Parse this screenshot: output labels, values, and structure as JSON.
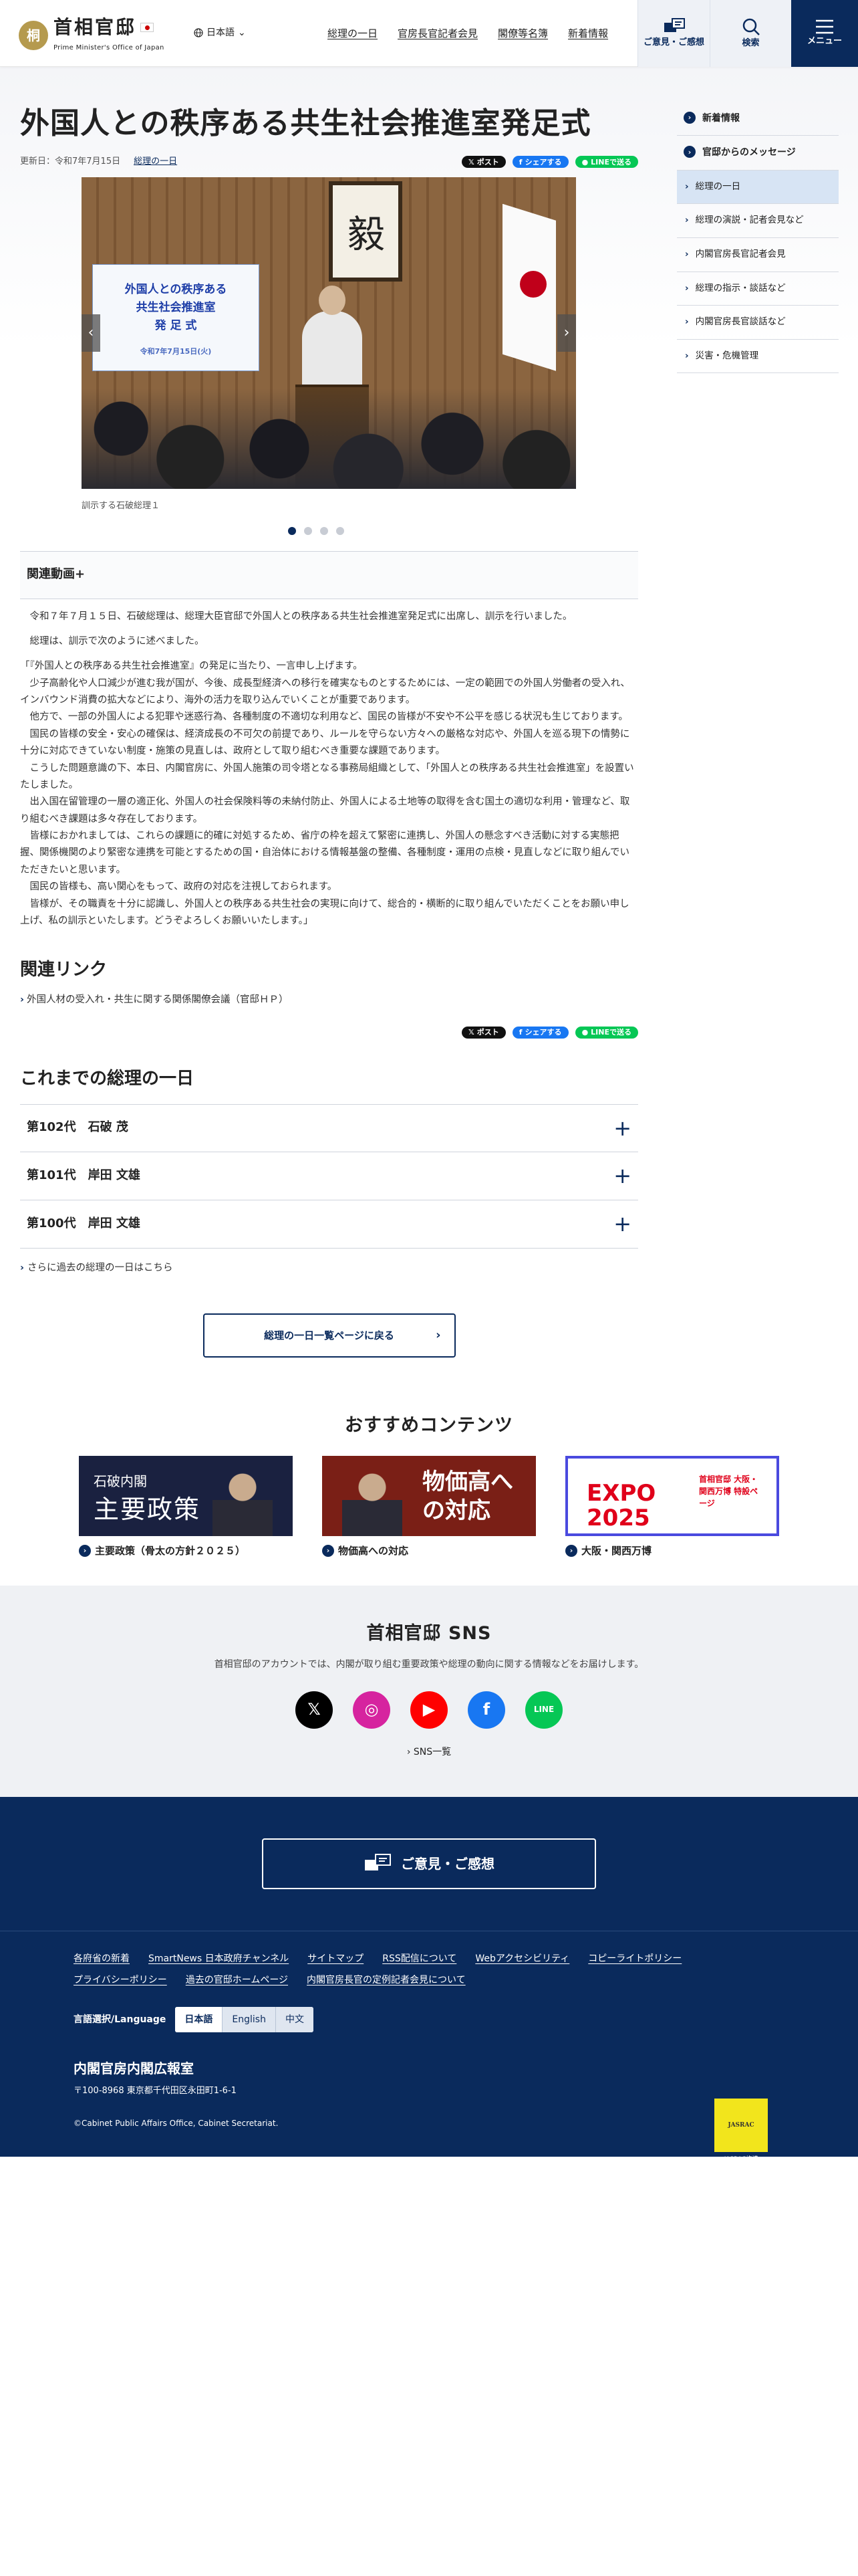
{
  "header": {
    "logo_ja": "首相官邸",
    "logo_en": "Prime Minister's Office of Japan",
    "lang": "日本語",
    "nav": [
      "総理の一日",
      "官房長官記者会見",
      "閣僚等名簿",
      "新着情報"
    ],
    "opinion": "ご意見・ご感想",
    "search": "検索",
    "menu": "メニュー"
  },
  "article": {
    "title": "外国人との秩序ある共生社会推進室発足式",
    "updated": "更新日：令和7年7月15日",
    "category": "総理の一日",
    "share": {
      "x": "ポスト",
      "fb": "シェアする",
      "line": "LINEで送る"
    },
    "slide": {
      "sign_lines": [
        "外国人との秩序ある",
        "共生社会推進室",
        "発 足 式"
      ],
      "sign_date": "令和7年7月15日(火)",
      "caption": "訓示する石破総理１",
      "count": 4,
      "active": 1
    },
    "video_label": "関連動画",
    "para1": "令和７年７月１５日、石破総理は、総理大臣官邸で外国人との秩序ある共生社会推進室発足式に出席し、訓示を行いました。",
    "para2": "総理は、訓示で次のように述べました。",
    "speech": [
      "「『外国人との秩序ある共生社会推進室』の発足に当たり、一言申し上げます。",
      "少子高齢化や人口減少が進む我が国が、今後、成長型経済への移行を確実なものとするためには、一定の範囲での外国人労働者の受入れ、インバウンド消費の拡大などにより、海外の活力を取り込んでいくことが重要であります。",
      "他方で、一部の外国人による犯罪や迷惑行為、各種制度の不適切な利用など、国民の皆様が不安や不公平を感じる状況も生じております。",
      "国民の皆様の安全・安心の確保は、経済成長の不可欠の前提であり、ルールを守らない方々への厳格な対応や、外国人を巡る現下の情勢に十分に対応できていない制度・施策の見直しは、政府として取り組むべき重要な課題であります。",
      "こうした問題意識の下、本日、内閣官房に、外国人施策の司令塔となる事務局組織として、「外国人との秩序ある共生社会推進室」を設置いたしました。",
      "出入国在留管理の一層の適正化、外国人の社会保険料等の未納付防止、外国人による土地等の取得を含む国土の適切な利用・管理など、取り組むべき課題は多々存在しております。",
      "皆様におかれましては、これらの課題に的確に対処するため、省庁の枠を超えて緊密に連携し、外国人の懸念すべき活動に対する実態把握、関係機関のより緊密な連携を可能とするための国・自治体における情報基盤の整備、各種制度・運用の点検・見直しなどに取り組んでいただきたいと思います。",
      "国民の皆様も、高い関心をもって、政府の対応を注視しておられます。",
      "皆様が、その職責を十分に認識し、外国人との秩序ある共生社会の実現に向けて、総合的・横断的に取り組んでいただくことをお願い申し上げ、私の訓示といたします。どうぞよろしくお願いいたします。」"
    ],
    "related_heading": "関連リンク",
    "related_link": "外国人材の受入れ・共生に関する関係閣僚会議（官邸ＨＰ）",
    "past_heading": "これまでの総理の一日",
    "past": [
      "第102代　石破 茂",
      "第101代　岸田 文雄",
      "第100代　岸田 文雄"
    ],
    "more_link": "さらに過去の総理の一日はこちら",
    "back": "総理の一日一覧ページに戻る"
  },
  "sidebar": {
    "items": [
      {
        "label": "新着情報",
        "type": "top"
      },
      {
        "label": "官邸からのメッセージ",
        "type": "top"
      },
      {
        "label": "総理の一日",
        "type": "sub",
        "active": true
      },
      {
        "label": "総理の演説・記者会見など",
        "type": "sub"
      },
      {
        "label": "内閣官房長官記者会見",
        "type": "sub"
      },
      {
        "label": "総理の指示・談話など",
        "type": "sub"
      },
      {
        "label": "内閣官房長官談話など",
        "type": "sub"
      },
      {
        "label": "災害・危機管理",
        "type": "sub"
      }
    ]
  },
  "recommend": {
    "heading": "おすすめコンテンツ",
    "cards": [
      {
        "label": "主要政策（骨太の方針２０２５）",
        "img1": "石破内閣",
        "img2": "主要政策"
      },
      {
        "label": "物価高への対応",
        "img1": "物価高への対応"
      },
      {
        "label": "大阪・関西万博",
        "img1": "EXPO 2025",
        "img2": "首相官邸 大阪・関西万博 特設ページ"
      }
    ]
  },
  "sns": {
    "heading": "首相官邸 SNS",
    "desc": "首相官邸のアカウントでは、内閣が取り組む重要政策や総理の動向に関する情報などをお届けします。",
    "icons": [
      {
        "name": "X",
        "color": "#000000"
      },
      {
        "name": "Instagram",
        "color": "#d6249f"
      },
      {
        "name": "YouTube",
        "color": "#ff0000"
      },
      {
        "name": "Facebook",
        "color": "#1877f2"
      },
      {
        "name": "LINE",
        "color": "#06c755"
      }
    ],
    "list": "SNS一覧"
  },
  "opinion_button": "ご意見・ご感想",
  "footer": {
    "links": [
      "各府省の新着",
      "SmartNews 日本政府チャンネル",
      "サイトマップ",
      "RSS配信について",
      "Webアクセシビリティ",
      "コピーライトポリシー",
      "プライバシーポリシー",
      "過去の官邸ホームページ",
      "内閣官房長官の定例記者会見について"
    ],
    "lang_label": "言語選択/Language",
    "langs": [
      "日本語",
      "English",
      "中文"
    ],
    "org": "内閣官房内閣広報室",
    "address": "〒100-8968 東京都千代田区永田町1-6-1",
    "copyright": "©Cabinet Public Affairs Office, Cabinet Secretariat.",
    "jasrac": "JASRAC許諾",
    "jasrac_no": "第J250902770号"
  },
  "colors": {
    "navy": "#0a2a5c",
    "active": "#d7e4f4"
  }
}
